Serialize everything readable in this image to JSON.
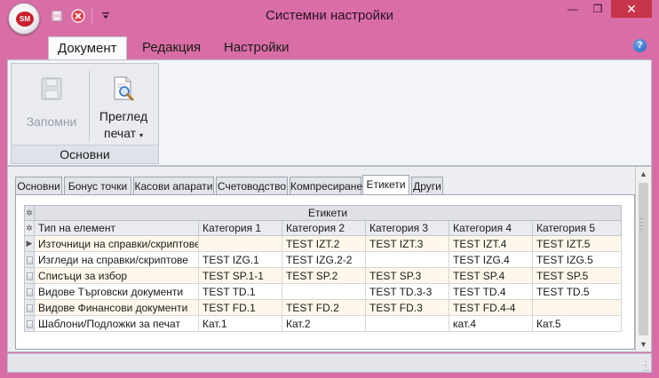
{
  "window": {
    "title": "Системни настройки",
    "logo_text": "SM",
    "controls": {
      "minimize": "—",
      "restore": "❐",
      "close": "✕"
    }
  },
  "ribbon": {
    "tabs": [
      {
        "label": "Документ",
        "active": true
      },
      {
        "label": "Редакция",
        "active": false
      },
      {
        "label": "Настройки",
        "active": false
      }
    ],
    "help": "?",
    "group": {
      "caption": "Основни",
      "save_label": "Запомни",
      "preview_label_line1": "Преглед",
      "preview_label_line2": "печат"
    }
  },
  "tabs": [
    {
      "label": "Основни",
      "active": false
    },
    {
      "label": "Бонус точки",
      "active": false
    },
    {
      "label": "Касови апарати",
      "active": false
    },
    {
      "label": "Счетоводство",
      "active": false
    },
    {
      "label": "Компресиране",
      "active": false
    },
    {
      "label": "Етикети",
      "active": true
    },
    {
      "label": "Други",
      "active": false
    }
  ],
  "grid": {
    "band_title": "Етикети",
    "columns": [
      "Тип на елемент",
      "Категория 1",
      "Категория 2",
      "Категория 3",
      "Категория 4",
      "Категория 5"
    ],
    "rows": [
      [
        "Източници на справки/скриптове",
        "",
        "TEST IZT.2",
        "TEST IZT.3",
        "TEST IZT.4",
        "TEST IZT.5"
      ],
      [
        "Изгледи на справки/скриптове",
        "TEST IZG.1",
        "TEST IZG.2-2",
        "",
        "TEST IZG.4",
        "TEST IZG.5"
      ],
      [
        "Списъци за избор",
        "TEST SP.1-1",
        "TEST SP.2",
        "TEST SP.3",
        "TEST SP.4",
        "TEST SP.5"
      ],
      [
        "Видове Търговски документи",
        "TEST TD.1",
        "",
        "TEST TD.3-3",
        "TEST TD.4",
        "TEST TD.5"
      ],
      [
        "Видове Финансови документи",
        "TEST FD.1",
        "TEST FD.2",
        "TEST FD.3",
        "TEST FD.4-4",
        ""
      ],
      [
        "Шаблони/Подложки за печат",
        "Кат.1",
        "Кат.2",
        "",
        "кат.4",
        "Кат.5"
      ]
    ]
  },
  "colors": {
    "frame": "#d96ea6",
    "close_button": "#c7354a",
    "row_highlight": "#fff8ea"
  }
}
